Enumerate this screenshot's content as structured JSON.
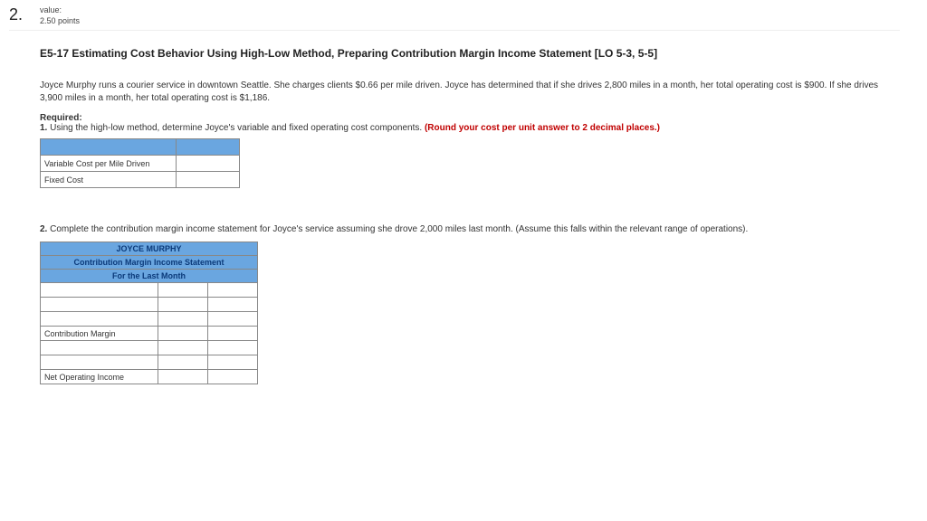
{
  "question": {
    "number": "2.",
    "value_label": "value:",
    "value_points": "2.50 points"
  },
  "title": "E5-17 Estimating Cost Behavior Using High-Low Method, Preparing Contribution Margin Income Statement [LO 5-3, 5-5]",
  "scenario": "Joyce Murphy runs a courier service in downtown Seattle. She charges clients $0.66 per mile driven. Joyce has determined that if she drives 2,800 miles in a month, her total operating cost is $900. If she drives 3,900 miles in a month, her total operating cost is $1,186.",
  "required_label": "Required:",
  "req1_prefix": "1.",
  "req1_text": "Using the high-low method, determine Joyce's variable and fixed operating cost components.",
  "req1_red": "(Round your cost per unit answer to 2 decimal places.)",
  "table1": {
    "row1": "Variable Cost per Mile Driven",
    "row2": "Fixed Cost"
  },
  "req2_prefix": "2.",
  "req2_text": "Complete the contribution margin income statement for Joyce's service assuming she drove 2,000 miles last month. (Assume this falls within the relevant range of operations).",
  "table2": {
    "h1": "JOYCE MURPHY",
    "h2": "Contribution Margin Income Statement",
    "h3": "For the Last Month",
    "cm": "Contribution Margin",
    "noi": "Net Operating Income"
  }
}
